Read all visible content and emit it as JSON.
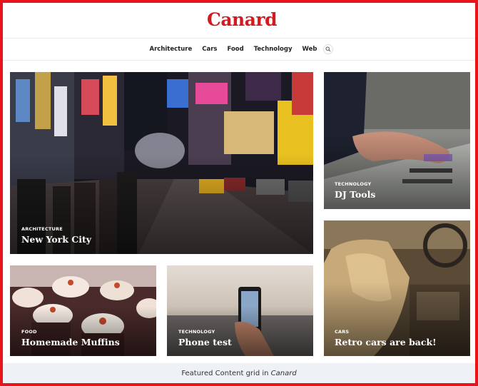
{
  "site": {
    "title": "Canard"
  },
  "nav": {
    "items": [
      "Architecture",
      "Cars",
      "Food",
      "Technology",
      "Web"
    ],
    "search_icon": "search-icon"
  },
  "tiles": [
    {
      "category": "ARCHITECTURE",
      "title": "New York City"
    },
    {
      "category": "TECHNOLOGY",
      "title": "DJ Tools"
    },
    {
      "category": "FOOD",
      "title": "Homemade Muffins"
    },
    {
      "category": "TECHNOLOGY",
      "title": "Phone test"
    },
    {
      "category": "CARS",
      "title": "Retro cars are back!"
    }
  ],
  "caption": {
    "text": "Featured Content grid in ",
    "site_name": "Canard"
  },
  "colors": {
    "brand": "#d11b21",
    "frame": "#e8141b",
    "caption_bg": "#eef2f6"
  }
}
